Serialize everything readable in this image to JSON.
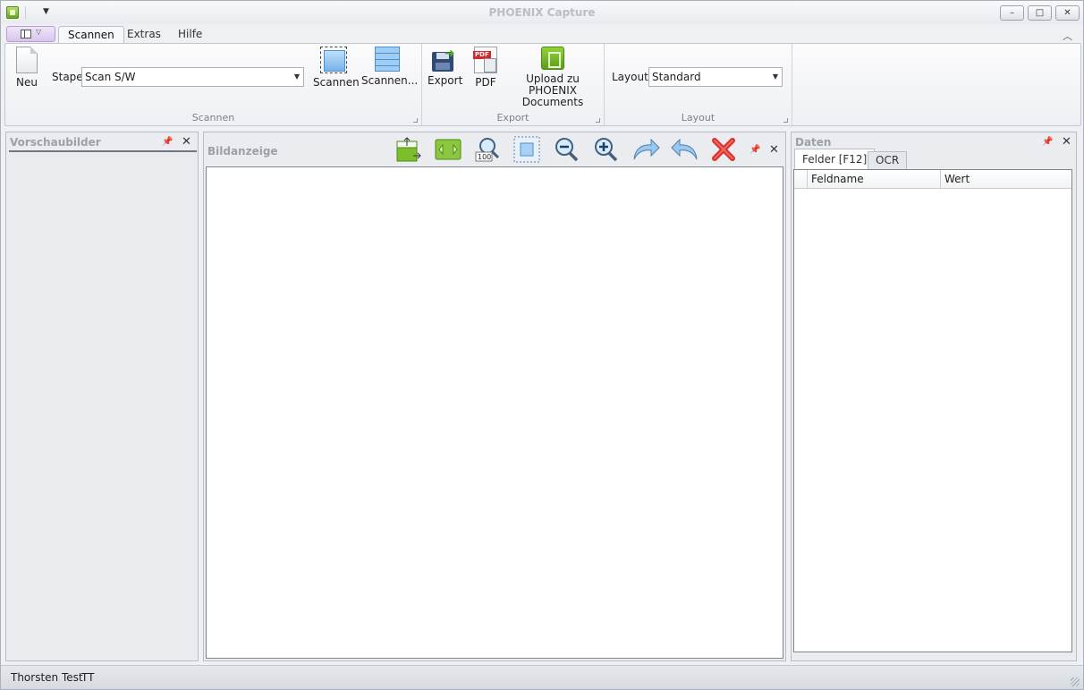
{
  "window": {
    "title": "PHOENIX Capture"
  },
  "titlebar": {
    "minimize": "–",
    "maximize": "□",
    "close": "✕",
    "qat_dropdown": "▼"
  },
  "ribbon_tabs": [
    "Scannen",
    "Extras",
    "Hilfe"
  ],
  "ribbon": {
    "groups": {
      "scannen": {
        "label": "Scannen",
        "new_label": "Neu",
        "stapel_label": "Stapel",
        "stapel_value": "Scan S/W",
        "scan_label": "Scannen",
        "scan_more_label": "Scannen..."
      },
      "export": {
        "label": "Export",
        "export_label": "Export",
        "pdf_label": "PDF",
        "pdf_tag": "PDF",
        "upload_label_1": "Upload zu PHOENIX",
        "upload_label_2": "Documents"
      },
      "layout": {
        "label": "Layout",
        "layouts_label": "Layouts",
        "layouts_value": "Standard"
      }
    }
  },
  "panels": {
    "thumbnails": {
      "title": "Vorschaubilder"
    },
    "viewer": {
      "title": "Bildanzeige",
      "toolbar": [
        {
          "name": "fit-page-icon"
        },
        {
          "name": "fit-width-icon"
        },
        {
          "name": "zoom-100-icon",
          "text": "100"
        },
        {
          "name": "select-area-icon"
        },
        {
          "name": "zoom-out-icon"
        },
        {
          "name": "zoom-in-icon"
        },
        {
          "name": "rotate-right-icon"
        },
        {
          "name": "rotate-left-icon"
        },
        {
          "name": "delete-icon"
        }
      ]
    },
    "data": {
      "title": "Daten",
      "tabs": [
        "Felder  [F12]",
        "OCR"
      ],
      "columns": [
        "Feldname",
        "Wert"
      ]
    }
  },
  "statusbar": {
    "user": "Thorsten Test",
    "initials": "TT"
  },
  "colors": {
    "accent_green": "#6aa31f",
    "accent_blue": "#4f8fcb",
    "delete_red": "#d9302b"
  }
}
